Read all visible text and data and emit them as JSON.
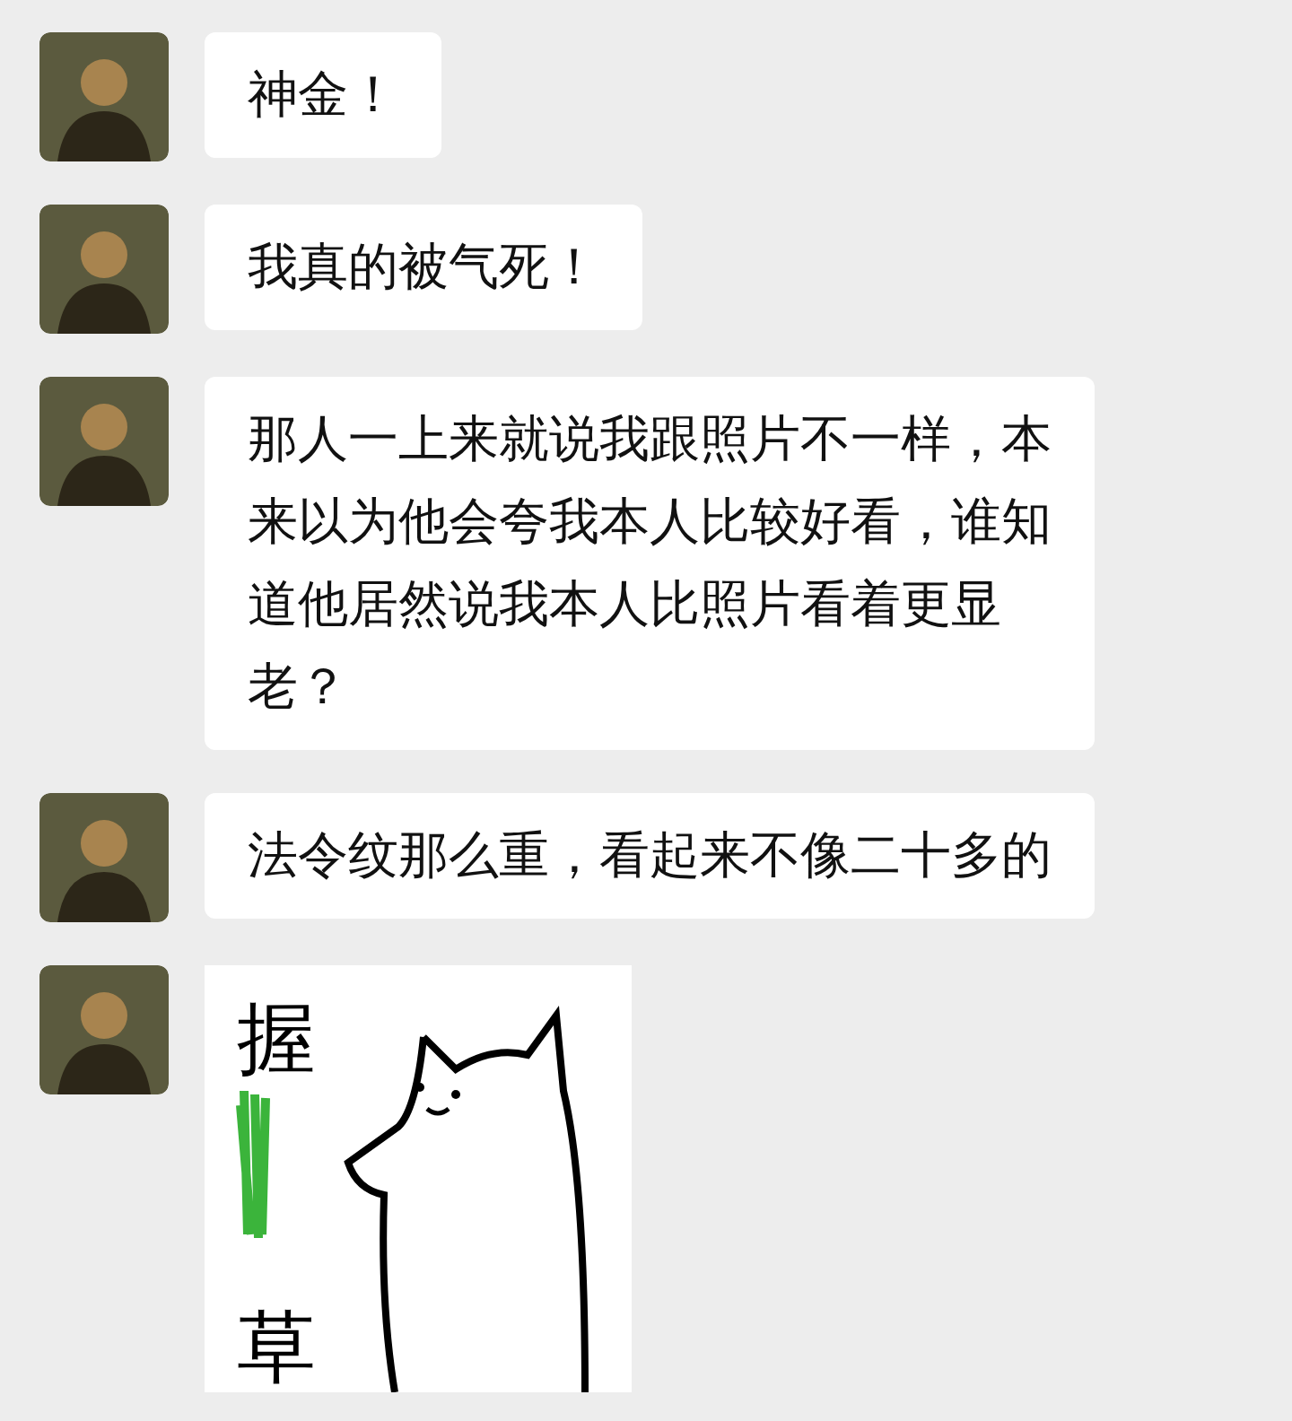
{
  "messages": [
    {
      "kind": "text",
      "text": "神金！"
    },
    {
      "kind": "text",
      "text": "我真的被气死！"
    },
    {
      "kind": "text",
      "text": "那人一上来就说我跟照片不一样，本来以为他会夸我本人比较好看，谁知道他居然说我本人比照片看着更显老？"
    },
    {
      "kind": "text",
      "text": "法令纹那么重，看起来不像二十多的"
    },
    {
      "kind": "sticker",
      "top_text": "握",
      "bottom_text": "草"
    }
  ]
}
